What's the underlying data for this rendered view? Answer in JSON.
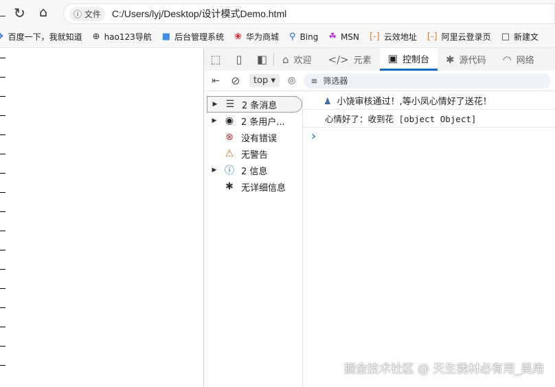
{
  "browser": {
    "back_icon": "back",
    "info_label": "文件",
    "url": "C:/Users/lyj/Desktop/设计模式Demo.html"
  },
  "bookmarks": [
    {
      "icon": "paw-icon",
      "glyph": "❖",
      "label": "百度一下，我就知道",
      "color": "#2f6ce5"
    },
    {
      "icon": "globe-icon",
      "glyph": "⊕",
      "label": "hao123导航",
      "color": "#333"
    },
    {
      "icon": "square-icon",
      "glyph": "■",
      "label": "后台管理系统",
      "color": "#3a8ee6"
    },
    {
      "icon": "huawei-icon",
      "glyph": "❀",
      "label": "华为商城",
      "color": "#e0242b"
    },
    {
      "icon": "search-icon",
      "glyph": "⚲",
      "label": "Bing",
      "color": "#1e6fd9"
    },
    {
      "icon": "msn-icon",
      "glyph": "☘",
      "label": "MSN",
      "color": "#b33ad9"
    },
    {
      "icon": "aliyun-icon",
      "glyph": "[-]",
      "label": "云效地址",
      "color": "#f07b1d"
    },
    {
      "icon": "aliyun-icon",
      "glyph": "[-]",
      "label": "阿里云登录页",
      "color": "#f07b1d"
    },
    {
      "icon": "folder-icon",
      "glyph": "□",
      "label": "新建文",
      "color": "#333"
    }
  ],
  "devtools": {
    "tabs": [
      {
        "name": "welcome",
        "icon": "⌂",
        "label": "欢迎"
      },
      {
        "name": "elements",
        "icon": "</>",
        "label": "元素"
      },
      {
        "name": "console",
        "icon": "▣",
        "label": "控制台",
        "active": true
      },
      {
        "name": "sources",
        "icon": "✱",
        "label": "源代码"
      },
      {
        "name": "network",
        "icon": "◠",
        "label": "网络"
      }
    ],
    "context": "top",
    "filter_placeholder": "筛选器",
    "sidebar": [
      {
        "label": "2 条消息",
        "icon": "☰",
        "arrow": true,
        "selected": true,
        "color": "#333"
      },
      {
        "label": "2 条用户...",
        "icon": "◉",
        "arrow": true,
        "color": "#222"
      },
      {
        "label": "没有错误",
        "icon": "⊗",
        "arrow": false,
        "color": "#d13438"
      },
      {
        "label": "无警告",
        "icon": "⚠",
        "arrow": false,
        "color": "#c87533"
      },
      {
        "label": "2 信息",
        "icon": "ⓘ",
        "arrow": true,
        "color": "#0f6cbd"
      },
      {
        "label": "无详细信息",
        "icon": "✱",
        "arrow": false,
        "color": "#333"
      }
    ],
    "messages": [
      {
        "icon": "♟",
        "text": "小饶审核通过！,等小凤心情好了送花！"
      },
      {
        "text": "心情好了：收到花 [object Object]"
      }
    ],
    "prompt": "›"
  },
  "watermark": "掘金技术社区 @ 天生我材必有用_吴用"
}
